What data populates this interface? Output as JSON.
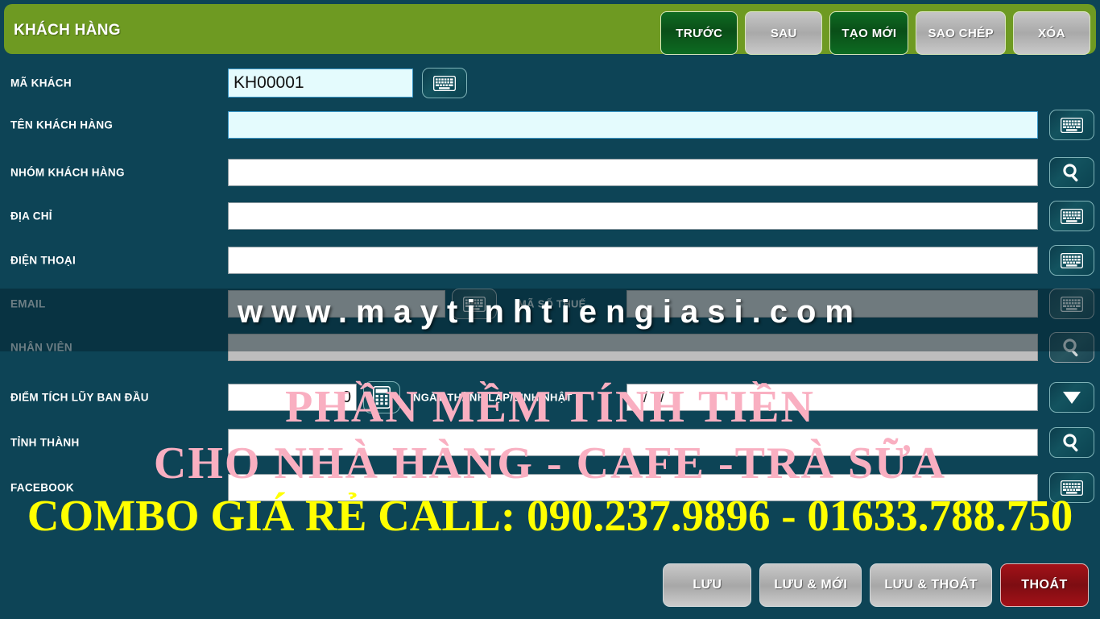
{
  "window": {
    "title": "KHÁCH HÀNG",
    "bg_color": "#0d4456",
    "header_color": "#6e9a22"
  },
  "header_buttons": [
    {
      "label": "TRƯỚC",
      "style": "green"
    },
    {
      "label": "SAU",
      "style": "grey"
    },
    {
      "label": "TẠO MỚI",
      "style": "green"
    },
    {
      "label": "SAO CHÉP",
      "style": "grey"
    },
    {
      "label": "XÓA",
      "style": "grey"
    }
  ],
  "fields": {
    "ma_khach": {
      "label": "MÃ KHÁCH",
      "value": "KH00001",
      "icon": "keyboard-icon"
    },
    "ten_khach_hang": {
      "label": "TÊN KHÁCH HÀNG",
      "value": "",
      "icon": "keyboard-icon"
    },
    "nhom_khach_hang": {
      "label": "NHÓM KHÁCH HÀNG",
      "value": "",
      "icon": "search-icon"
    },
    "dia_chi": {
      "label": "ĐỊA CHỈ",
      "value": "",
      "icon": "keyboard-icon"
    },
    "dien_thoai": {
      "label": "ĐIỆN THOẠI",
      "value": "",
      "icon": "keyboard-icon"
    },
    "email": {
      "label": "EMAIL",
      "value": "",
      "icon": "keyboard-icon"
    },
    "ma_so_thue": {
      "label": "MÃ SỐ THUẾ",
      "value": "",
      "icon": "keyboard-icon"
    },
    "nhan_vien": {
      "label": "NHÂN VIÊN",
      "value": "",
      "icon": "search-icon"
    },
    "diem_tich_luy": {
      "label": "ĐIỂM TÍCH LŨY BAN ĐẦU",
      "value": "0",
      "icon": "calculator-icon"
    },
    "ngay_thanh_lap": {
      "label": "NGÀY THÀNH LẬP/SINH NHẬT",
      "value": "  /  /",
      "icon": "dropdown-icon"
    },
    "tinh_thanh": {
      "label": "TỈNH THÀNH",
      "value": "",
      "icon": "search-icon"
    },
    "facebook": {
      "label": "FACEBOOK",
      "value": "",
      "icon": "keyboard-icon"
    }
  },
  "watermarks": {
    "url": "www.maytinhtiengiasi.com",
    "pink_line1": "PHẦN MỀM TÍNH TIỀN",
    "pink_line2": "CHO NHÀ HÀNG - CAFE -TRÀ SỮA",
    "yellow": "COMBO GIÁ RẺ CALL: 090.237.9896 - 01633.788.750"
  },
  "footer_buttons": [
    {
      "label": "LƯU",
      "style": "grey"
    },
    {
      "label": "LƯU & MỚI",
      "style": "grey"
    },
    {
      "label": "LƯU & THOÁT",
      "style": "grey"
    },
    {
      "label": "THOÁT",
      "style": "red"
    }
  ]
}
